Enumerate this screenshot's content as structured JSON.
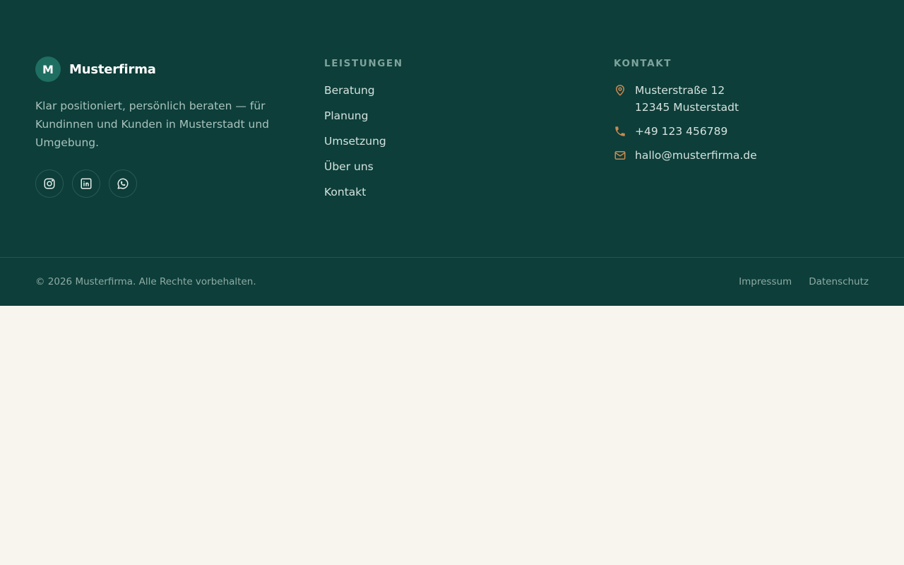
{
  "brand": {
    "badge": "M",
    "name": "Musterfirma",
    "description": "Klar positioniert, persönlich beraten — für Kundinnen und Kunden in Musterstadt und Umgebung.",
    "socials": [
      {
        "icon": "instagram-icon"
      },
      {
        "icon": "linkedin-icon"
      },
      {
        "icon": "whatsapp-icon"
      }
    ]
  },
  "services": {
    "title": "LEISTUNGEN",
    "items": [
      "Beratung",
      "Planung",
      "Umsetzung",
      "Über uns",
      "Kontakt"
    ]
  },
  "contact": {
    "title": "KONTAKT",
    "address_line1": "Musterstraße 12",
    "address_line2": "12345 Musterstadt",
    "phone": "+49 123 456789",
    "email": "hallo@musterfirma.de",
    "icons": [
      "map-pin-icon",
      "phone-icon",
      "mail-icon"
    ]
  },
  "bottom": {
    "copyright": "© 2026 Musterfirma. Alle Rechte vorbehalten.",
    "impressum": "Impressum",
    "datenschutz": "Datenschutz"
  },
  "colors": {
    "footer_bg": "#0d3e39",
    "accent": "#c98a52",
    "badge": "#1f6e62",
    "page_bg": "#f8f5ef"
  }
}
